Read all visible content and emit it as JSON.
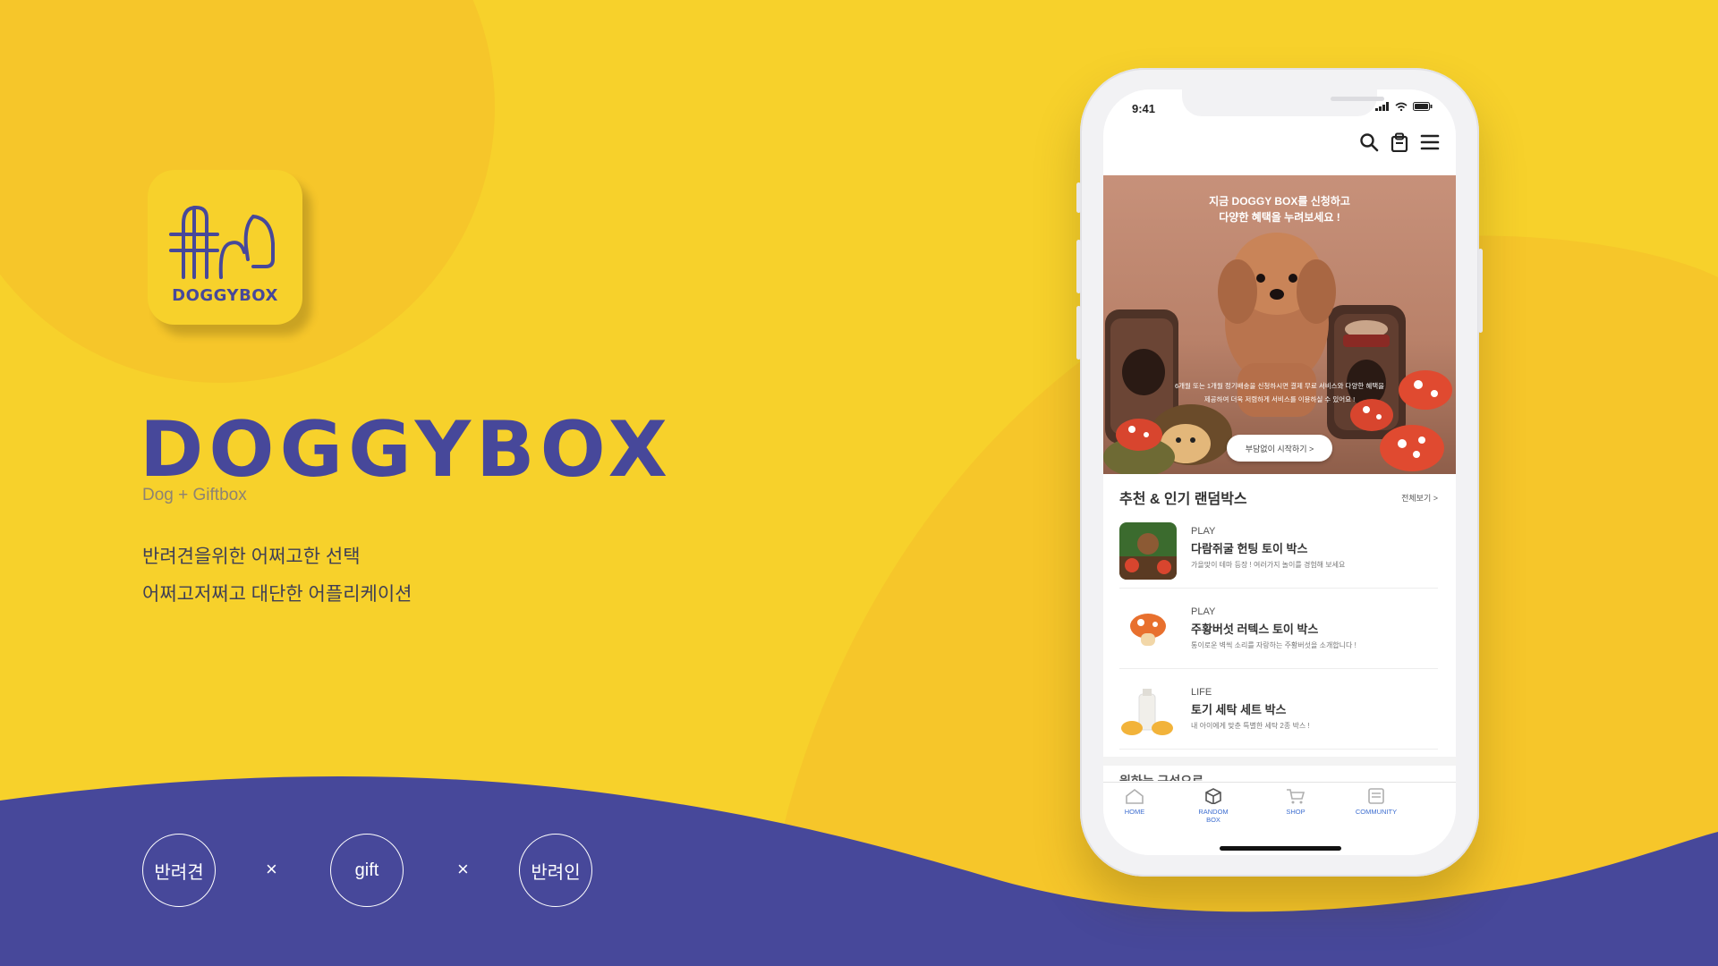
{
  "brand": {
    "logo_text": "DOGGYBOX",
    "name": "DOGGYBOX",
    "tagline": "Dog + Giftbox",
    "desc_lines": [
      "반려견을위한 어쩌고한 선택",
      "어쩌고저쩌고 대단한 어플리케이션"
    ]
  },
  "chips": [
    {
      "label": "반려견"
    },
    {
      "label": "gift"
    },
    {
      "label": "반려인"
    }
  ],
  "separator": "×",
  "phone": {
    "status_time": "9:41",
    "hero": {
      "title_line1": "지금 DOGGY BOX를 신청하고",
      "title_line2": "다양한 혜택을 누려보세요 !",
      "sub_line1": "6개월 또는 1개월 정기배송을 신청하시면 결제 무료 서비스와 다양한 혜택을",
      "sub_line2": "제공하여 더욱 저렴하게 서비스를 이용하실 수 있어요 !",
      "button_label": "부담없이 시작하기 >"
    },
    "section": {
      "title": "추천 & 인기 랜덤박스",
      "more_label": "전체보기 >"
    },
    "items": [
      {
        "category": "PLAY",
        "name": "다람쥐굴 헌팅 토이 박스",
        "desc": "가을맞이 테마 등장 ! 여러가지 놀이를 경험해 보세요"
      },
      {
        "category": "PLAY",
        "name": "주황버섯 러텍스 토이 박스",
        "desc": "통이로운 벽씩 소리를 자랑하는 주황버섯을 소개합니다 !"
      },
      {
        "category": "LIFE",
        "name": "토기 세탁 세트 박스",
        "desc": "내 아이에게 맞춘 특별한 세탁 2종 박스 !"
      }
    ],
    "cut_section_title": "원하는 구성으로",
    "tabs": [
      {
        "label": "HOME"
      },
      {
        "label": "RANDOM BOX"
      },
      {
        "label": "SHOP"
      },
      {
        "label": "COMMUNITY"
      }
    ]
  },
  "colors": {
    "background": "#F7D12B",
    "accent_purple": "#47489A",
    "tab_blue": "#3E6ED0"
  },
  "icons": [
    "search-icon",
    "shopping-bag-icon",
    "menu-icon",
    "home-icon",
    "box-icon",
    "cart-icon",
    "document-icon",
    "signal-icon",
    "wifi-icon",
    "battery-icon"
  ]
}
